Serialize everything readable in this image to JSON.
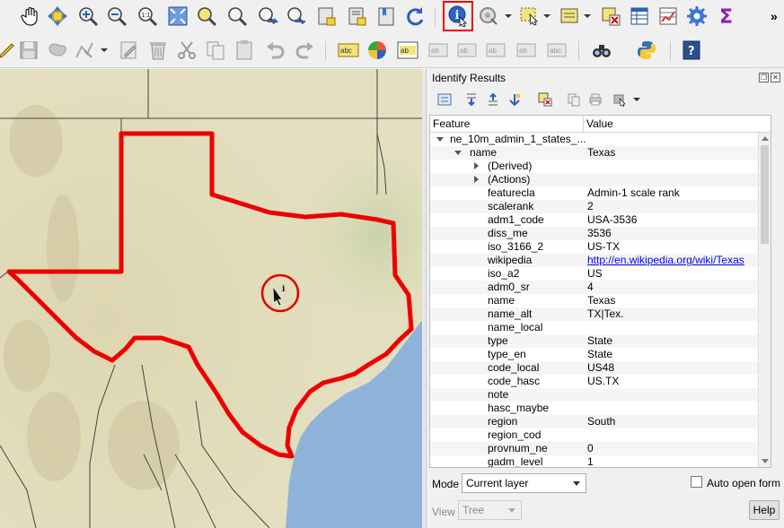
{
  "panel": {
    "title": "Identify Results",
    "columns": {
      "feature": "Feature",
      "value": "Value"
    },
    "layer_name": "ne_10m_admin_1_states_...",
    "feature_key": "name",
    "feature_value": "Texas",
    "derived": "(Derived)",
    "actions": "(Actions)",
    "attributes": [
      {
        "key": "featurecla",
        "value": "Admin-1 scale rank"
      },
      {
        "key": "scalerank",
        "value": "2"
      },
      {
        "key": "adm1_code",
        "value": "USA-3536"
      },
      {
        "key": "diss_me",
        "value": "3536"
      },
      {
        "key": "iso_3166_2",
        "value": "US-TX"
      },
      {
        "key": "wikipedia",
        "value": "http://en.wikipedia.org/wiki/Texas"
      },
      {
        "key": "iso_a2",
        "value": "US"
      },
      {
        "key": "adm0_sr",
        "value": "4"
      },
      {
        "key": "name",
        "value": "Texas"
      },
      {
        "key": "name_alt",
        "value": "TX|Tex."
      },
      {
        "key": "name_local",
        "value": ""
      },
      {
        "key": "type",
        "value": "State"
      },
      {
        "key": "type_en",
        "value": "State"
      },
      {
        "key": "code_local",
        "value": "US48"
      },
      {
        "key": "code_hasc",
        "value": "US.TX"
      },
      {
        "key": "note",
        "value": ""
      },
      {
        "key": "hasc_maybe",
        "value": ""
      },
      {
        "key": "region",
        "value": "South"
      },
      {
        "key": "region_cod",
        "value": ""
      },
      {
        "key": "provnum_ne",
        "value": "0"
      },
      {
        "key": "gadm_level",
        "value": "1"
      }
    ],
    "mode_label": "Mode",
    "mode_value": "Current layer",
    "auto_open_label": "Auto open form",
    "view_label": "View",
    "view_value": "Tree",
    "help_label": "Help"
  },
  "toolbar": {
    "more": "»"
  },
  "colors": {
    "state_outline": "#ee0000",
    "water": "#8fb3d9",
    "land": "#e9e4c8",
    "highlight": "#e00000"
  }
}
